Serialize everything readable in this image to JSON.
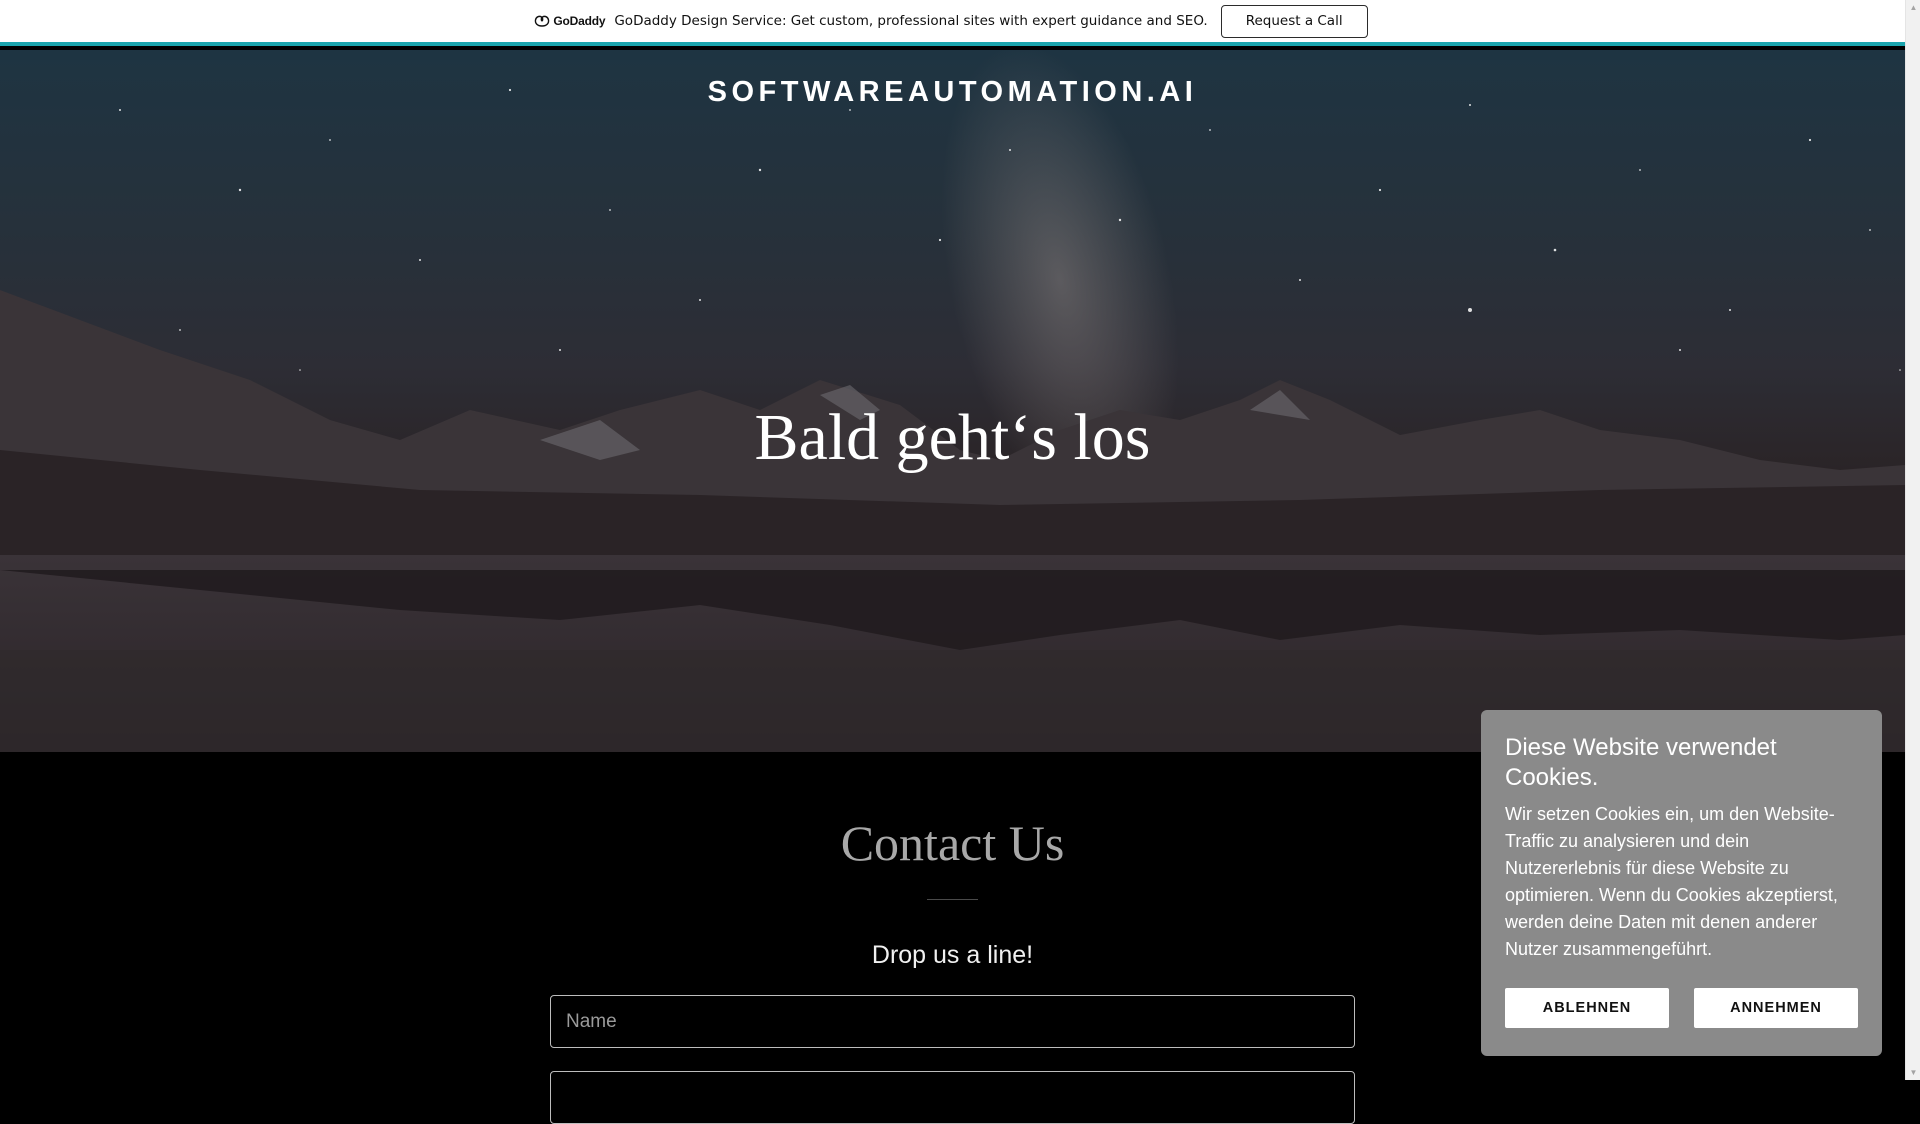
{
  "promo_bar": {
    "logo_text": "GoDaddy",
    "message": "GoDaddy Design Service: Get custom, professional sites with expert guidance and SEO.",
    "button_label": "Request a Call",
    "accent_color": "#1aa4ad"
  },
  "hero": {
    "site_title": "SOFTWAREAUTOMATION.AI",
    "heading": "Bald geht‘s los"
  },
  "contact": {
    "title": "Contact Us",
    "subtitle": "Drop us a line!",
    "name_placeholder": "Name",
    "email_placeholder": ""
  },
  "cookie_banner": {
    "title": "Diese Website verwendet Cookies.",
    "text": "Wir setzen Cookies ein, um den Website-Traffic zu analysieren und dein Nutzererlebnis für diese Website zu optimieren. Wenn du Cookies akzeptierst, werden deine Daten mit denen anderer Nutzer zusammengeführt.",
    "decline_label": "ABLEHNEN",
    "accept_label": "ANNEHMEN"
  },
  "icons": {
    "logo": "godaddy-logo-icon",
    "scroll_up": "scroll-up-arrow-icon",
    "scroll_down": "scroll-down-arrow-icon"
  }
}
